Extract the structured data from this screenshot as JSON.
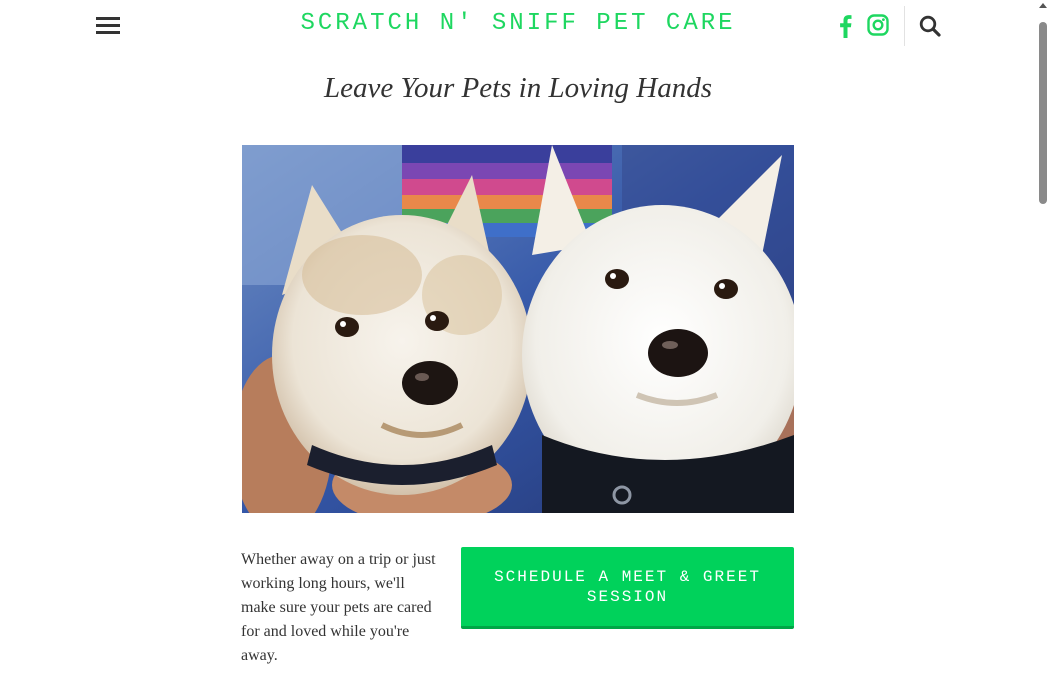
{
  "header": {
    "site_title": "SCRATCH N' SNIFF PET CARE",
    "accent_color": "#1ed760",
    "icons": [
      "menu-icon",
      "facebook-icon",
      "instagram-icon",
      "search-icon"
    ]
  },
  "main": {
    "heading": "Leave Your Pets in Loving Hands",
    "intro_text": "Whether away on a trip or just working long hours, we'll make sure your pets are cared for and loved while you're away.",
    "cta_label": "SCHEDULE A MEET & GREET SESSION",
    "cta_color": "#00d25b"
  }
}
